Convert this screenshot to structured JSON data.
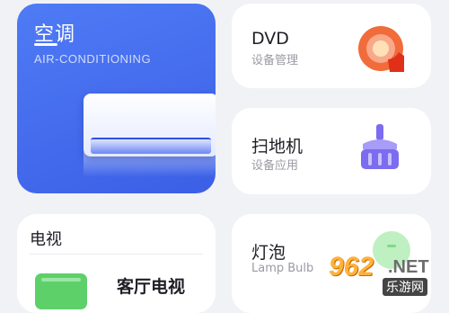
{
  "ac_card": {
    "title": "空调",
    "subtitle": "AIR-CONDITIONING"
  },
  "devices": [
    {
      "name": "DVD",
      "subtitle": "设备管理",
      "icon": "disc-icon"
    },
    {
      "name": "扫地机",
      "subtitle": "设备应用",
      "icon": "sweeper-brush-icon"
    },
    {
      "name": "灯泡",
      "subtitle": "Lamp Bulb",
      "icon": "bulb-icon"
    }
  ],
  "tv_card": {
    "heading": "电视",
    "room": "客厅电视",
    "icon": "tv-icon"
  },
  "watermark": {
    "number": "962",
    "net": ".NET",
    "site": "乐游网"
  },
  "colors": {
    "ac_gradient_start": "#4f7bf5",
    "ac_gradient_end": "#3b5fe6",
    "dvd_orange": "#f26b3a",
    "sweeper_purple": "#7b6cf0",
    "bulb_green": "#bff0c2",
    "tv_green": "#5ed06a",
    "background": "#f1f2f6"
  }
}
